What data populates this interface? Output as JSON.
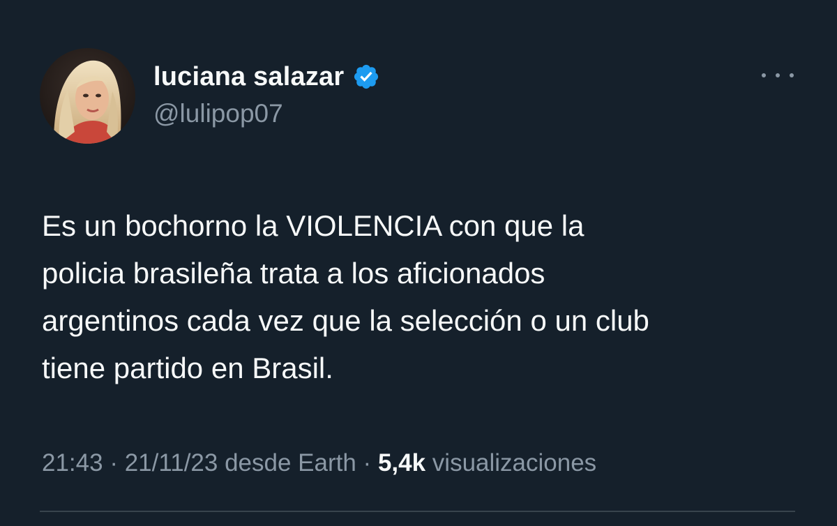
{
  "author": {
    "display_name": "luciana salazar",
    "handle": "@lulipop07",
    "verified": true,
    "avatar_icon": "profile-photo",
    "verified_icon": "verified-badge-icon"
  },
  "menu": {
    "icon": "more-options-icon"
  },
  "tweet": {
    "lines": [
      "Es un bochorno la VIOLENCIA con que la",
      "policia brasileña trata a los aficionados",
      "argentinos cada vez que la selección o un club",
      "tiene partido en Brasil."
    ]
  },
  "meta": {
    "time": "21:43",
    "separator_1": " · ",
    "date": "21/11/23",
    "source": " desde Earth",
    "separator_2": " · ",
    "views_count": "5,4k",
    "views_label": " visualizaciones"
  },
  "colors": {
    "background": "#15202b",
    "text_primary": "#f7f9f9",
    "text_secondary": "#8b98a5",
    "verified_blue": "#1d9bf0",
    "divider": "#38444d"
  }
}
